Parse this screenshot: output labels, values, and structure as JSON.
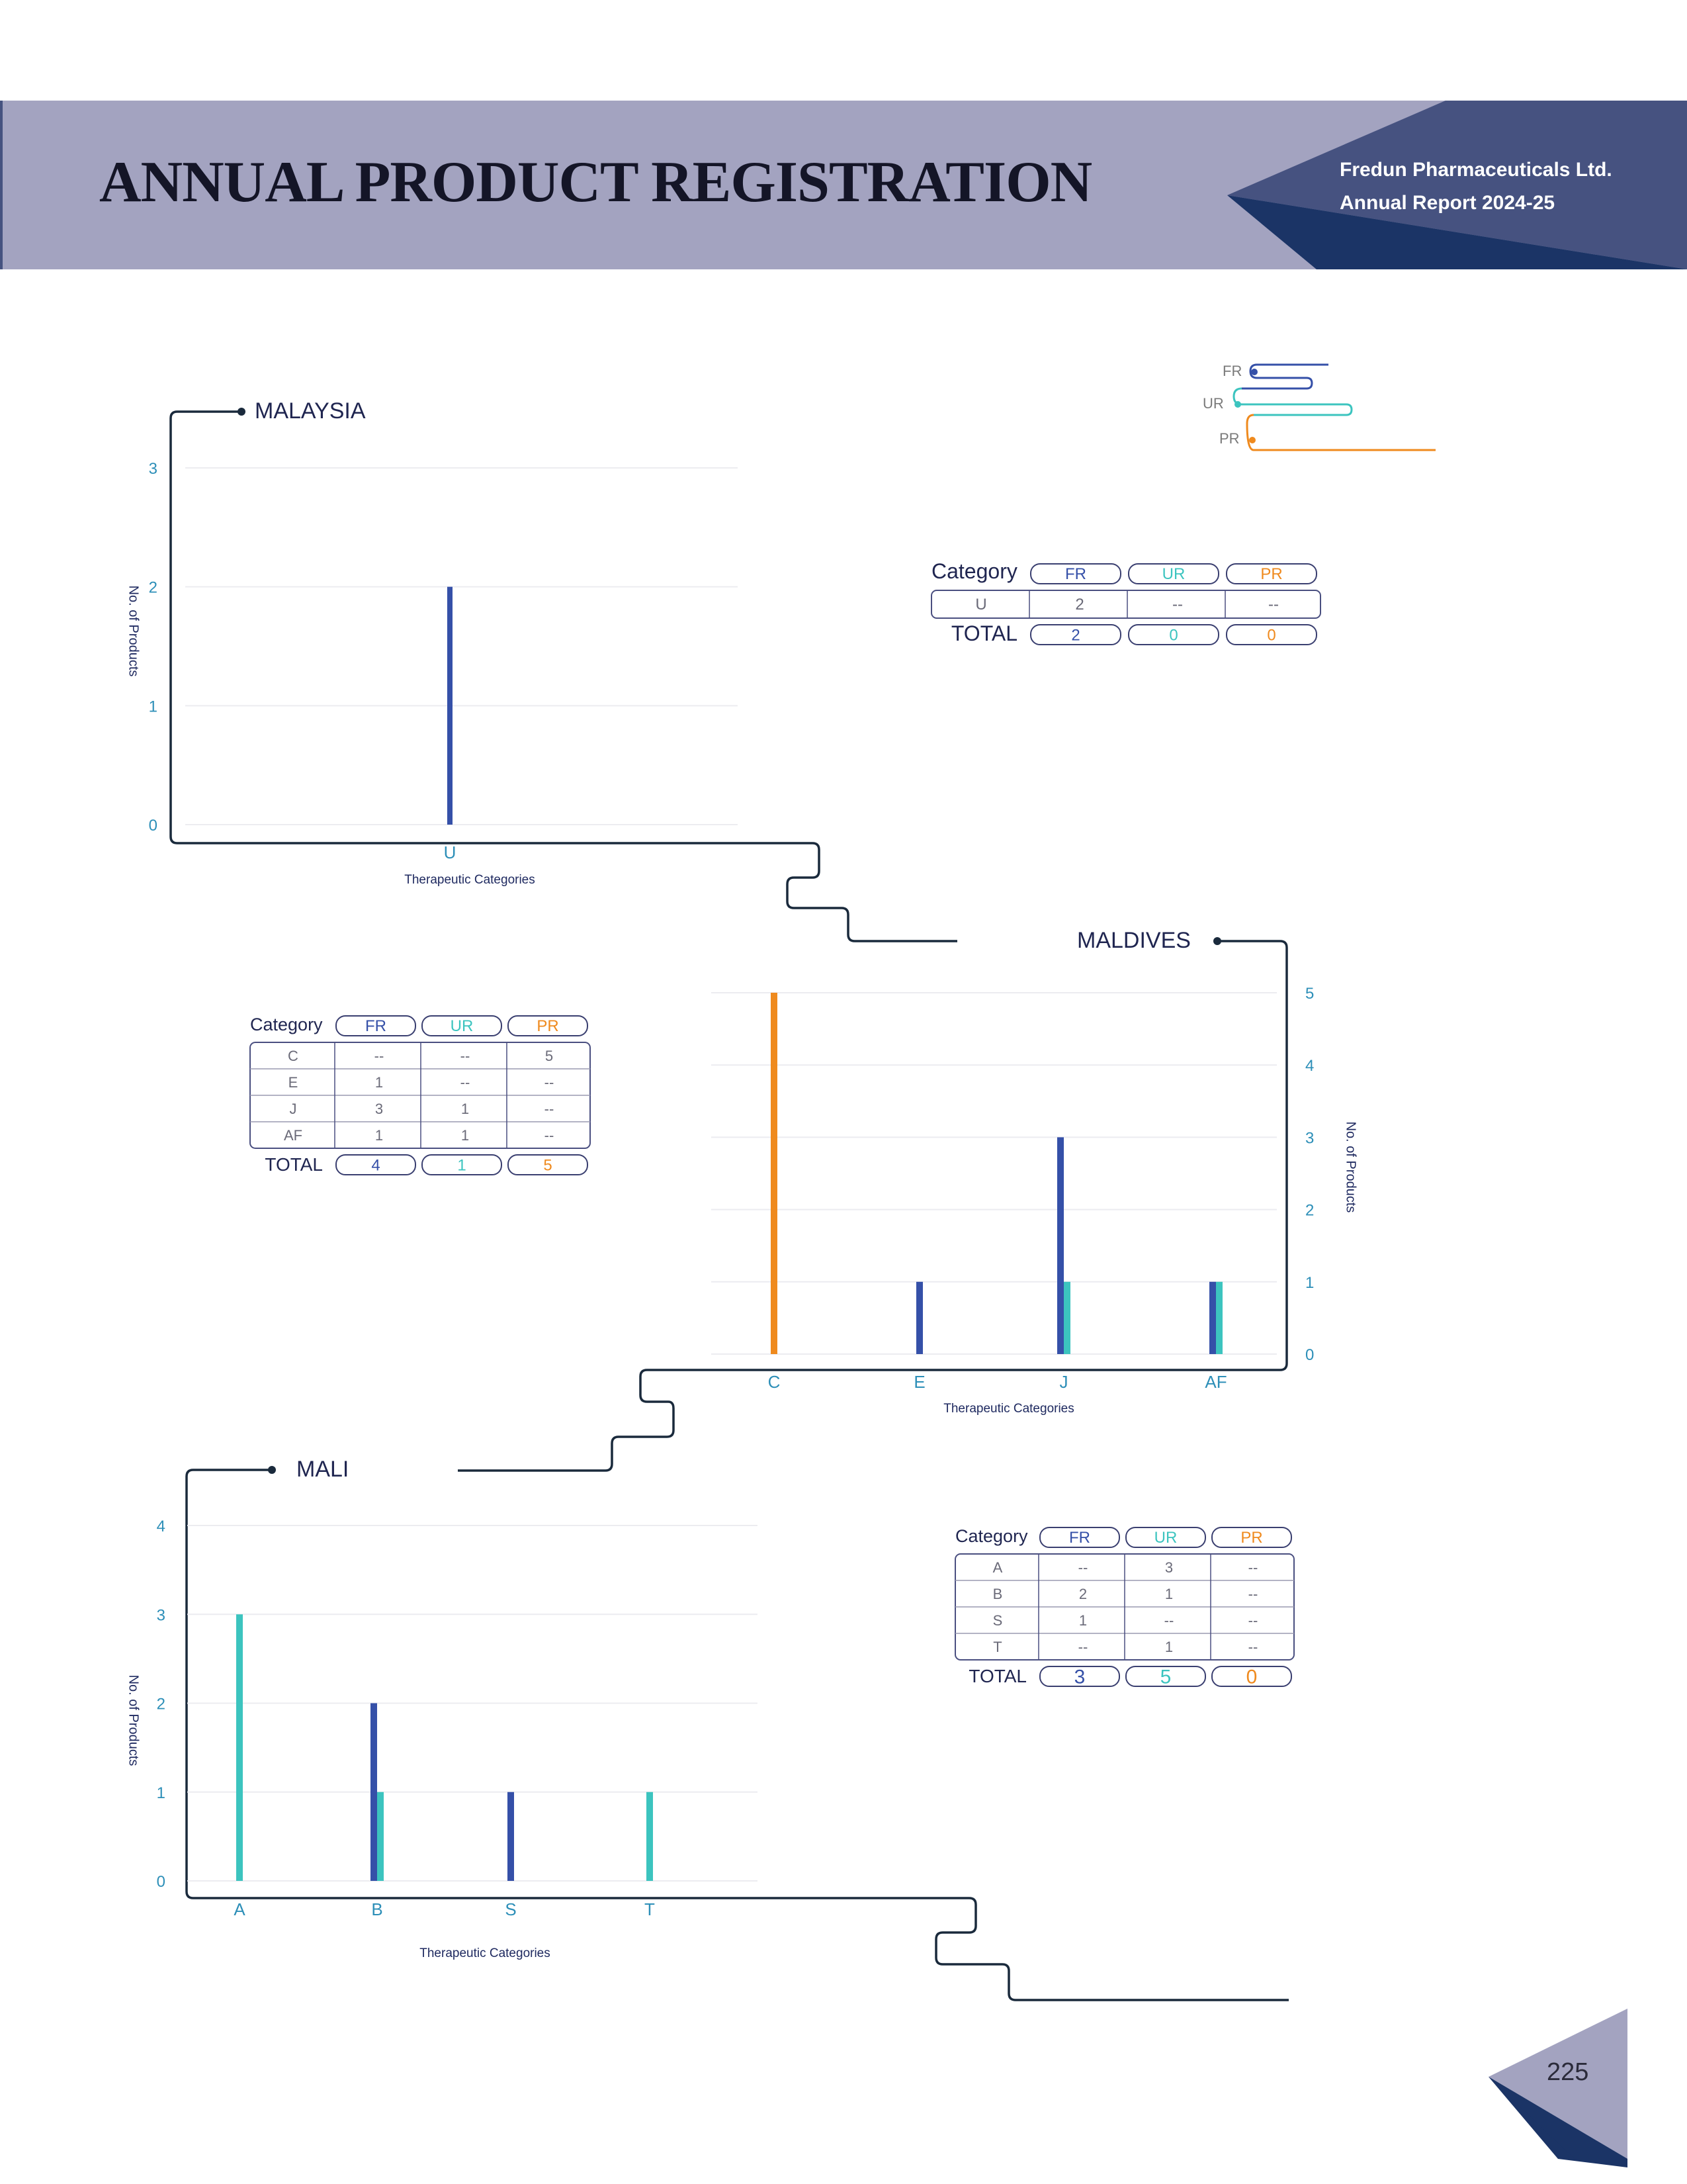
{
  "header": {
    "title": "ANNUAL PRODUCT REGISTRATION",
    "company": "Fredun Pharmaceuticals Ltd.",
    "report": "Annual Report 2024-25",
    "colors": {
      "band": "#a3a3c0",
      "dark_blue": "#465280",
      "navy": "#1b3466"
    }
  },
  "legend": {
    "items": [
      {
        "label": "FR",
        "color": "#3550a8"
      },
      {
        "label": "UR",
        "color": "#3cc4bf"
      },
      {
        "label": "PR",
        "color": "#ef8a1e"
      }
    ]
  },
  "page_number": "225",
  "tables": {
    "malaysia": {
      "header": [
        "Category",
        "FR",
        "UR",
        "PR"
      ],
      "rows": [
        [
          "U",
          "2",
          "--",
          "--"
        ]
      ],
      "total_label": "TOTAL",
      "totals": [
        "2",
        "0",
        "0"
      ]
    },
    "maldives": {
      "header": [
        "Category",
        "FR",
        "UR",
        "PR"
      ],
      "rows": [
        [
          "C",
          "--",
          "--",
          "5"
        ],
        [
          "E",
          "1",
          "--",
          "--"
        ],
        [
          "J",
          "3",
          "1",
          "--"
        ],
        [
          "AF",
          "1",
          "1",
          "--"
        ]
      ],
      "total_label": "TOTAL",
      "totals": [
        "4",
        "1",
        "5"
      ]
    },
    "mali": {
      "header": [
        "Category",
        "FR",
        "UR",
        "PR"
      ],
      "rows": [
        [
          "A",
          "--",
          "3",
          "--"
        ],
        [
          "B",
          "2",
          "1",
          "--"
        ],
        [
          "S",
          "1",
          "--",
          "--"
        ],
        [
          "T",
          "--",
          "1",
          "--"
        ]
      ],
      "total_label": "TOTAL",
      "totals": [
        "3",
        "5",
        "0"
      ]
    }
  },
  "chart_data": [
    {
      "type": "bar",
      "title": "MALAYSIA",
      "xlabel": "Therapeutic Categories",
      "ylabel": "No. of Products",
      "categories": [
        "U"
      ],
      "series": [
        {
          "name": "FR",
          "values": [
            2
          ]
        },
        {
          "name": "UR",
          "values": [
            0
          ]
        },
        {
          "name": "PR",
          "values": [
            0
          ]
        }
      ],
      "yticks": [
        0,
        1,
        2,
        3
      ],
      "ylim": [
        0,
        3
      ],
      "grid": true
    },
    {
      "type": "bar",
      "title": "MALDIVES",
      "xlabel": "Therapeutic Categories",
      "ylabel": "No. of Products",
      "categories": [
        "C",
        "E",
        "J",
        "AF"
      ],
      "series": [
        {
          "name": "FR",
          "values": [
            0,
            1,
            3,
            1
          ]
        },
        {
          "name": "UR",
          "values": [
            0,
            0,
            1,
            1
          ]
        },
        {
          "name": "PR",
          "values": [
            5,
            0,
            0,
            0
          ]
        }
      ],
      "yticks": [
        0,
        1,
        2,
        3,
        4,
        5
      ],
      "ylim": [
        0,
        5
      ],
      "y_axis_side": "right",
      "grid": true
    },
    {
      "type": "bar",
      "title": "MALI",
      "xlabel": "Therapeutic Categories",
      "ylabel": "No. of Products",
      "categories": [
        "A",
        "B",
        "S",
        "T"
      ],
      "series": [
        {
          "name": "FR",
          "values": [
            0,
            2,
            1,
            0
          ]
        },
        {
          "name": "UR",
          "values": [
            3,
            1,
            0,
            1
          ]
        },
        {
          "name": "PR",
          "values": [
            0,
            0,
            0,
            0
          ]
        }
      ],
      "yticks": [
        0,
        1,
        2,
        3,
        4
      ],
      "ylim": [
        0,
        4
      ],
      "grid": true
    }
  ]
}
